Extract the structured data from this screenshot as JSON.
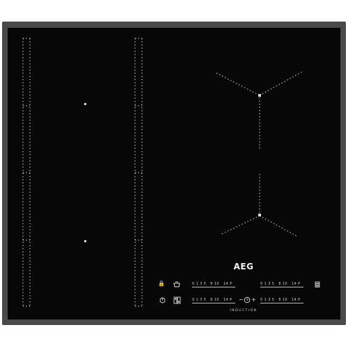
{
  "appliance": {
    "brand": "AEG",
    "type_label": "INDUCTION"
  },
  "controls": {
    "power_slider_scale": "0 1 3 5   8 10   14 P",
    "icons": {
      "lock": "lock-icon",
      "stop_go": "pot-icon",
      "on_off": "power-icon",
      "bridge": "bridge-icon",
      "timer": "timer-icon",
      "timer_minus": "minus-icon",
      "timer_plus": "plus-icon",
      "hob2hood": "hob2hood-icon"
    },
    "timer_minus_glyph": "−",
    "timer_plus_glyph": "+",
    "timer_glyph": "◷",
    "lock_glyph": "🔒",
    "power_glyph": "⏻"
  },
  "colors": {
    "frame": "#4a4a4c",
    "glass": "#070707",
    "markings": "#d9d9d9"
  }
}
